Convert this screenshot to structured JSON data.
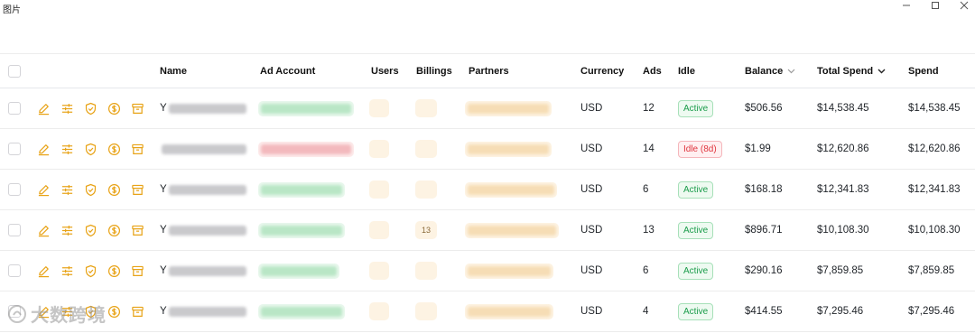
{
  "window": {
    "title": "图片"
  },
  "table": {
    "headers": {
      "name": "Name",
      "ad_account": "Ad Account",
      "users": "Users",
      "billings": "Billings",
      "partners": "Partners",
      "currency": "Currency",
      "ads": "Ads",
      "idle": "Idle",
      "balance": "Balance",
      "total_spend": "Total Spend",
      "spend": "Spend"
    },
    "sort_icons": {
      "balance": "chevron-down-icon",
      "total_spend": "chevron-down-icon"
    },
    "action_icons": [
      "edit-icon",
      "sliders-icon",
      "shield-check-icon",
      "dollar-circle-icon",
      "archive-icon"
    ],
    "rows": [
      {
        "name_prefix": "Y",
        "users_visible": "",
        "billings_visible": "",
        "currency": "USD",
        "ads": "12",
        "idle": "Active",
        "status": "active",
        "balance": "$506.56",
        "total_spend": "$14,538.45",
        "spend": "$14,538.45",
        "account_color": "green"
      },
      {
        "name_prefix": "",
        "users_visible": "",
        "billings_visible": "",
        "currency": "USD",
        "ads": "14",
        "idle": "Idle (8d)",
        "status": "idle",
        "balance": "$1.99",
        "total_spend": "$12,620.86",
        "spend": "$12,620.86",
        "account_color": "red"
      },
      {
        "name_prefix": "Y",
        "users_visible": "",
        "billings_visible": "",
        "currency": "USD",
        "ads": "6",
        "idle": "Active",
        "status": "active",
        "balance": "$168.18",
        "total_spend": "$12,341.83",
        "spend": "$12,341.83",
        "account_color": "green"
      },
      {
        "name_prefix": "Y",
        "users_visible": "",
        "billings_visible": "13",
        "currency": "USD",
        "ads": "13",
        "idle": "Active",
        "status": "active",
        "balance": "$896.71",
        "total_spend": "$10,108.30",
        "spend": "$10,108.30",
        "account_color": "green"
      },
      {
        "name_prefix": "Y",
        "users_visible": "",
        "billings_visible": "",
        "currency": "USD",
        "ads": "6",
        "idle": "Active",
        "status": "active",
        "balance": "$290.16",
        "total_spend": "$7,859.85",
        "spend": "$7,859.85",
        "account_color": "green"
      },
      {
        "name_prefix": "Y",
        "users_visible": "",
        "billings_visible": "",
        "currency": "USD",
        "ads": "4",
        "idle": "Active",
        "status": "active",
        "balance": "$414.55",
        "total_spend": "$7,295.46",
        "spend": "$7,295.46",
        "account_color": "green"
      }
    ]
  },
  "watermark": {
    "text": "大数跨境"
  },
  "colors": {
    "action_icon": "#e8a317",
    "active_green": "#1a9c4a",
    "idle_red": "#e0343d"
  }
}
